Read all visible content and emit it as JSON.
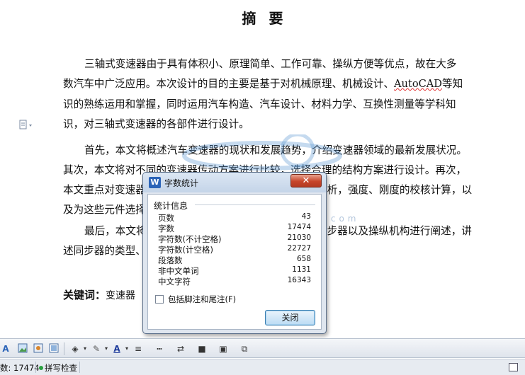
{
  "document": {
    "title": "摘要",
    "para1": [
      "三轴式变速器由于具有体积小、原理简单、工作可靠、操纵方便等优点，故在大多",
      "数汽车中广泛应用。本次设计的目的主要是基于对机械原理、机械设计、",
      "等知",
      "识的熟练运用和掌握，同时运用汽车构造、汽车设计、材料力学、互换性测量等学科知",
      "识，对三轴式变速器的各部件进行设计。"
    ],
    "autocad": "AutoCAD",
    "para2": [
      "首先，本文将概述汽车变速器的现状和发展趋势，介绍变速器领域的最新发展状况。",
      "其次，本文将对不同的变速器传动方案进行比较，选择合理的结构方案进行设计。再次，",
      "本文重点对变速器",
      "析，强度、刚度的校核计算，以",
      "及为这些元件选择"
    ],
    "para3": [
      "最后，本文将",
      "步器以及操纵机构进行阐述，讲",
      "述同步器的类型、"
    ],
    "keywords_label": "关键词：",
    "keywords_text": "变速器",
    "watermark_url": "www.renrendoc.com"
  },
  "dialog": {
    "title": "字数统计",
    "close_glyph": "✕",
    "group_title": "统计信息",
    "stats": [
      {
        "label": "页数",
        "value": "43"
      },
      {
        "label": "字数",
        "value": "17474"
      },
      {
        "label": "字符数(不计空格)",
        "value": "21030"
      },
      {
        "label": "字符数(计空格)",
        "value": "22727"
      },
      {
        "label": "段落数",
        "value": "658"
      },
      {
        "label": "非中文单词",
        "value": "1131"
      },
      {
        "label": "中文字符",
        "value": "16343"
      }
    ],
    "checkbox_label": "包括脚注和尾注(F)",
    "checkbox_checked": false,
    "ok_label": "关闭"
  },
  "status": {
    "word_count": "数: 17474",
    "spell_check": "拼写检查"
  },
  "icons": {
    "draw_toolbar": [
      "wordart-icon",
      "picture-icon",
      "clipart-icon",
      "image-icon",
      "fill-color-icon",
      "line-color-icon",
      "font-color-icon",
      "line-style-icon",
      "dash-style-icon",
      "arrow-style-icon",
      "shadow-icon",
      "3d-icon",
      "arrange-icon"
    ]
  },
  "colors": {
    "accent": "#2b64b8",
    "close_button": "#c7452a",
    "spell_underline": "#e03030"
  }
}
